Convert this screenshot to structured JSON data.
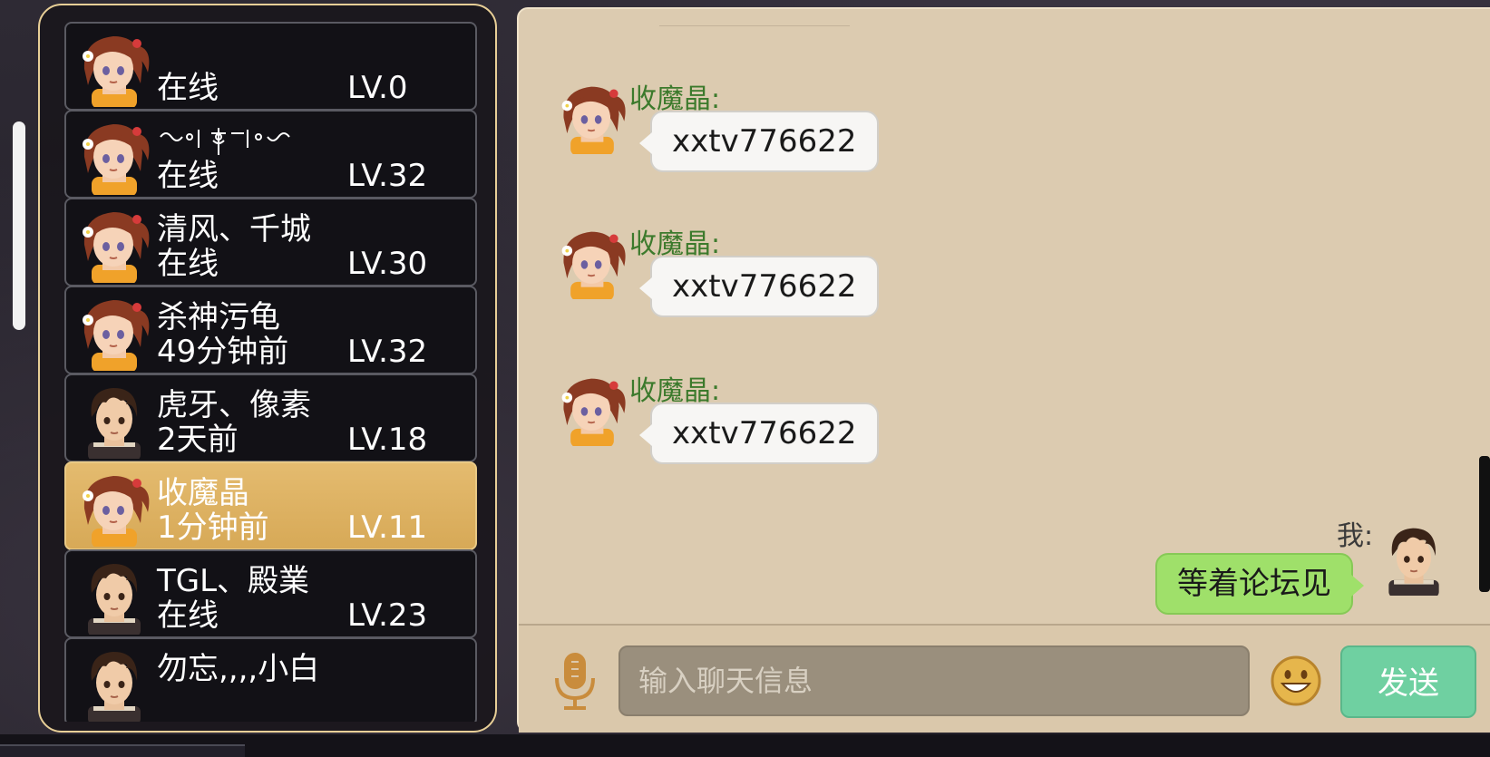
{
  "friends": [
    {
      "name": "",
      "status": "在线",
      "level": "LV.0",
      "avatar": "girl-avatar-icon",
      "selected": false
    },
    {
      "name": "",
      "name_image": "decorative-symbol-name",
      "status": "在线",
      "level": "LV.32",
      "avatar": "girl-avatar-icon",
      "selected": false
    },
    {
      "name": "清风、千城",
      "status": "在线",
      "level": "LV.30",
      "avatar": "girl-avatar-icon",
      "selected": false
    },
    {
      "name": "杀神污龟",
      "status": "49分钟前",
      "level": "LV.32",
      "avatar": "girl-avatar-icon",
      "selected": false
    },
    {
      "name": "虎牙、像素",
      "status": "2天前",
      "level": "LV.18",
      "avatar": "boy-avatar-icon",
      "selected": false
    },
    {
      "name": "收魔晶",
      "status": "1分钟前",
      "level": "LV.11",
      "avatar": "girl-avatar-icon",
      "selected": true
    },
    {
      "name": "TGL、殿業",
      "status": "在线",
      "level": "LV.23",
      "avatar": "boy-avatar-icon",
      "selected": false
    },
    {
      "name": "勿忘,,,,小白",
      "status": "",
      "level": "",
      "avatar": "boy-avatar-icon",
      "selected": false
    }
  ],
  "chat": {
    "messages": [
      {
        "sender": "收魔晶:",
        "text": "xxtv776622"
      },
      {
        "sender": "收魔晶:",
        "text": "xxtv776622"
      },
      {
        "sender": "收魔晶:",
        "text": "xxtv776622"
      }
    ],
    "my_message": {
      "sender": "我:",
      "text": "等着论坛见"
    },
    "input_placeholder": "输入聊天信息",
    "send_label": "发送"
  },
  "icons": {
    "mic": "microphone-icon",
    "emoji": "smiley-face-icon"
  },
  "colors": {
    "selected_row": "#d7a957",
    "chat_background": "#dccbb0",
    "sender_name": "#3c7a2c",
    "my_bubble": "#9fe06a",
    "send_button": "#6fd0a1"
  }
}
